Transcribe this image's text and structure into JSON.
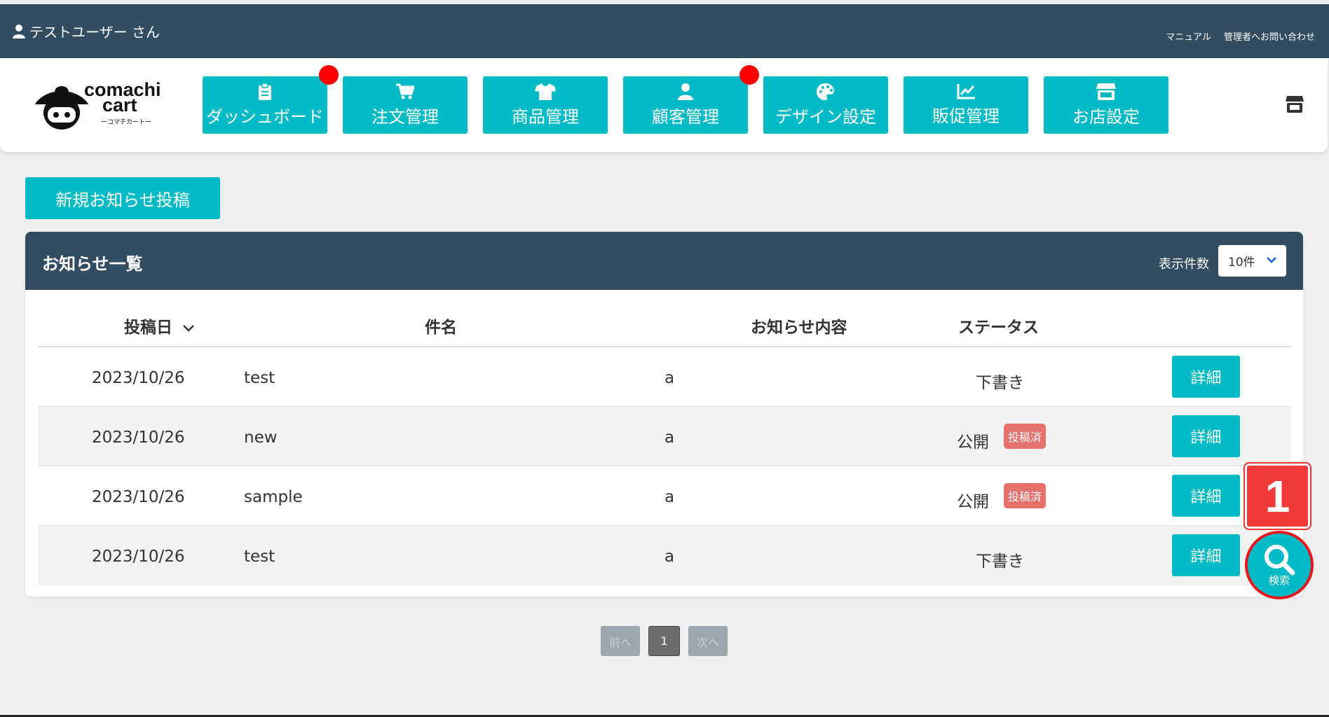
{
  "topbar": {
    "user_label": "テストユーザー さん",
    "manual_link": "マニュアル",
    "contact_link": "管理者へお問い合わせ"
  },
  "logo": {
    "line1": "comachi",
    "line2": "cart",
    "line3": "ーコマチカートー"
  },
  "nav": [
    {
      "label": "ダッシュボード",
      "icon": "clipboard-icon",
      "has_notification": true
    },
    {
      "label": "注文管理",
      "icon": "cart-icon",
      "has_notification": false
    },
    {
      "label": "商品管理",
      "icon": "tshirt-icon",
      "has_notification": false
    },
    {
      "label": "顧客管理",
      "icon": "user-icon",
      "has_notification": true
    },
    {
      "label": "デザイン設定",
      "icon": "palette-icon",
      "has_notification": false
    },
    {
      "label": "販促管理",
      "icon": "chart-line-icon",
      "has_notification": false
    },
    {
      "label": "お店設定",
      "icon": "store-icon",
      "has_notification": false
    }
  ],
  "new_post_button": "新規お知らせ投稿",
  "panel": {
    "title": "お知らせ一覧",
    "per_page_label": "表示件数",
    "per_page_value": "10件"
  },
  "table": {
    "headers": {
      "date": "投稿日",
      "subject": "件名",
      "content": "お知らせ内容",
      "status": "ステータス"
    },
    "rows": [
      {
        "date": "2023/10/26",
        "subject": "test",
        "content": "a",
        "status": "下書き",
        "badge": "",
        "action": "詳細"
      },
      {
        "date": "2023/10/26",
        "subject": "new",
        "content": "a",
        "status": "公開",
        "badge": "投稿済",
        "action": "詳細"
      },
      {
        "date": "2023/10/26",
        "subject": "sample",
        "content": "a",
        "status": "公開",
        "badge": "投稿済",
        "action": "詳細"
      },
      {
        "date": "2023/10/26",
        "subject": "test",
        "content": "a",
        "status": "下書き",
        "badge": "",
        "action": "詳細"
      }
    ]
  },
  "pagination": {
    "prev": "前へ",
    "current": "1",
    "next": "次へ"
  },
  "callout_number": "1",
  "search_fab_label": "検索",
  "colors": {
    "header_bg": "#324d62",
    "accent": "#00bac5",
    "notification": "#ff0000",
    "badge": "#e5706c",
    "callout": "#f23a3a"
  }
}
